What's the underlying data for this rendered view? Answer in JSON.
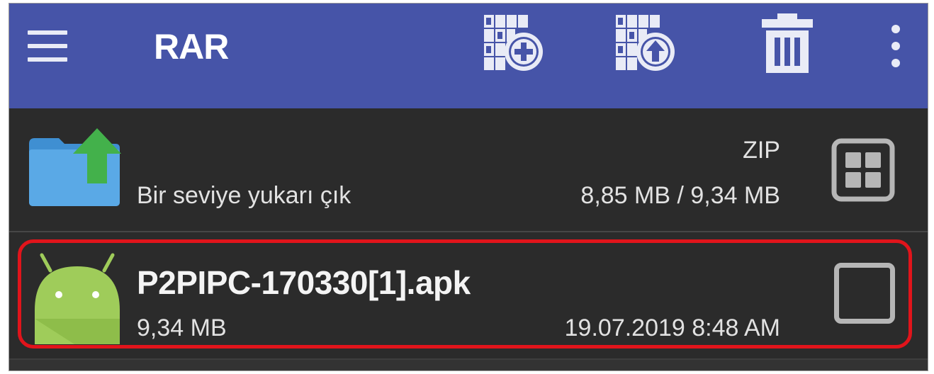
{
  "toolbar": {
    "title": "RAR",
    "icons": [
      "menu-icon",
      "archive-add-icon",
      "archive-extract-icon",
      "delete-icon",
      "more-vert-icon"
    ]
  },
  "parent_row": {
    "label": "Bir seviye yukarı çık",
    "archive_type": "ZIP",
    "size_info": "8,85 MB / 9,34 MB",
    "icon": "folder-up-icon",
    "action_icon": "grid-view-icon"
  },
  "file_row": {
    "name": "P2PIPC-170330[1].apk",
    "size": "9,34 MB",
    "date": "19.07.2019 8:48 AM",
    "icon": "android-icon",
    "checked": false
  },
  "colors": {
    "appbar": "#4654a8",
    "background": "#2b2b2b",
    "highlight": "#e1141b",
    "android_green": "#9fcc5a",
    "folder_blue": "#5aa9e6",
    "arrow_green": "#43b14b"
  }
}
